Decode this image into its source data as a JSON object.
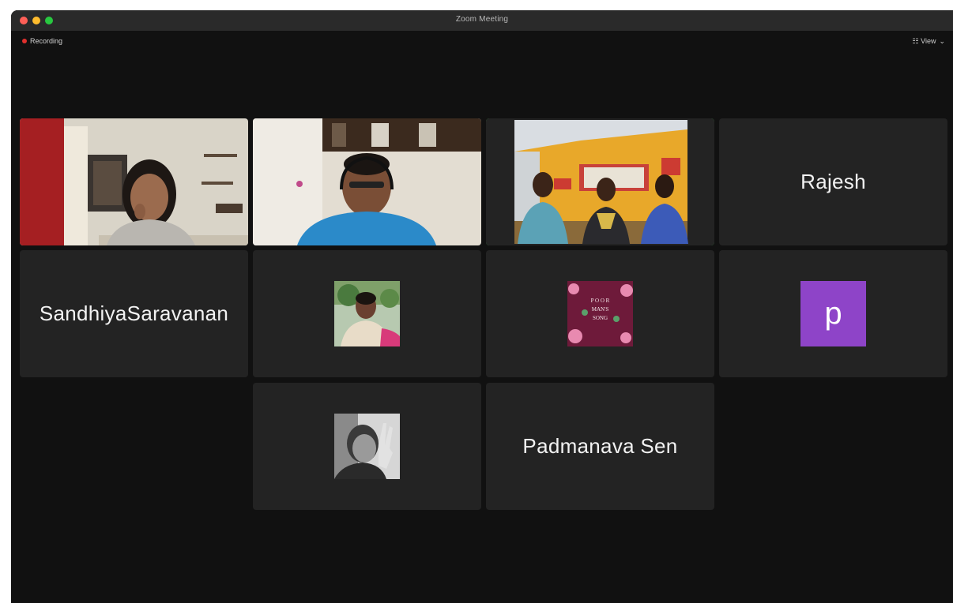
{
  "window": {
    "title": "Zoom Meeting",
    "recording_label": "Recording",
    "view_label": "☷ View"
  },
  "participants": [
    {
      "name": "Rajesh",
      "type": "name"
    },
    {
      "name": "SandhiyaSaravanan",
      "type": "name"
    },
    {
      "name": "p",
      "type": "letter-avatar",
      "color": "#8e44c8"
    },
    {
      "name": "Padmanava Sen",
      "type": "name"
    }
  ],
  "book_cover_text": {
    "line1": "P O O R",
    "line2": "MAN'S",
    "line3": "SONG"
  },
  "colors": {
    "window_bg": "#111111",
    "tile_bg": "#232323",
    "active_speaker": "#39b54a",
    "recording": "#e0302d"
  }
}
